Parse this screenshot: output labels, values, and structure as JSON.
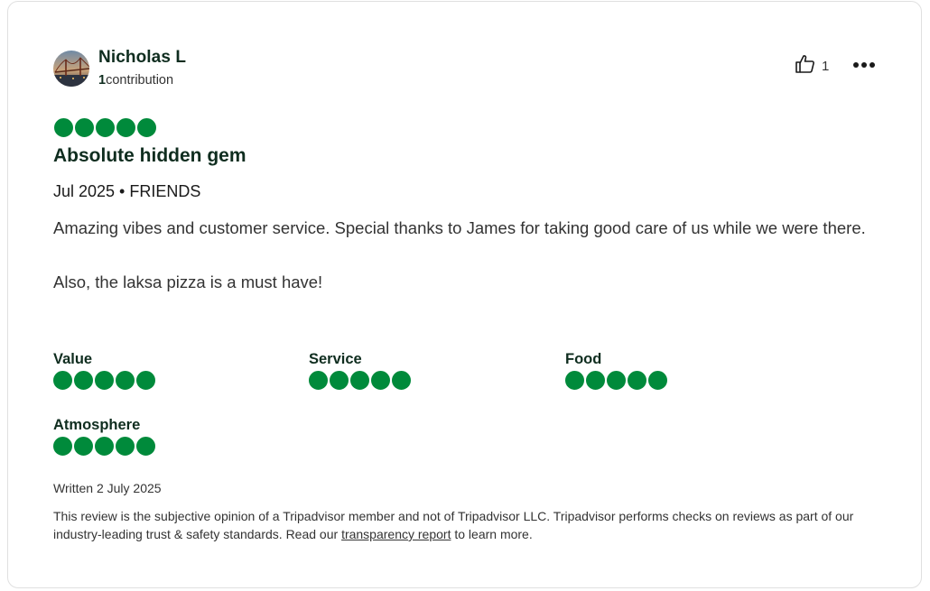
{
  "reviewer": {
    "name": "Nicholas L",
    "contribution_count": "1",
    "contribution_label": "contribution"
  },
  "helpful": {
    "count": "1",
    "icon": "thumbs-up-icon"
  },
  "more_icon": "more-icon",
  "rating": {
    "value": 5,
    "max": 5,
    "color": "#008a3b"
  },
  "review": {
    "title": "Absolute hidden gem",
    "meta": "Jul 2025 • FRIENDS",
    "paragraphs": [
      "Amazing vibes and customer service. Special thanks to James for taking good care of us while we were there.",
      "Also, the laksa pizza is a must have!"
    ]
  },
  "subratings": [
    {
      "label": "Value",
      "value": 5
    },
    {
      "label": "Service",
      "value": 5
    },
    {
      "label": "Food",
      "value": 5
    },
    {
      "label": "Atmosphere",
      "value": 5
    }
  ],
  "written": "Written 2 July 2025",
  "disclaimer": {
    "before": "This review is the subjective opinion of a Tripadvisor member and not of Tripadvisor LLC. Tripadvisor performs checks on reviews as part of our industry-leading trust & safety standards. Read our ",
    "link": "transparency report",
    "after": " to learn more."
  }
}
